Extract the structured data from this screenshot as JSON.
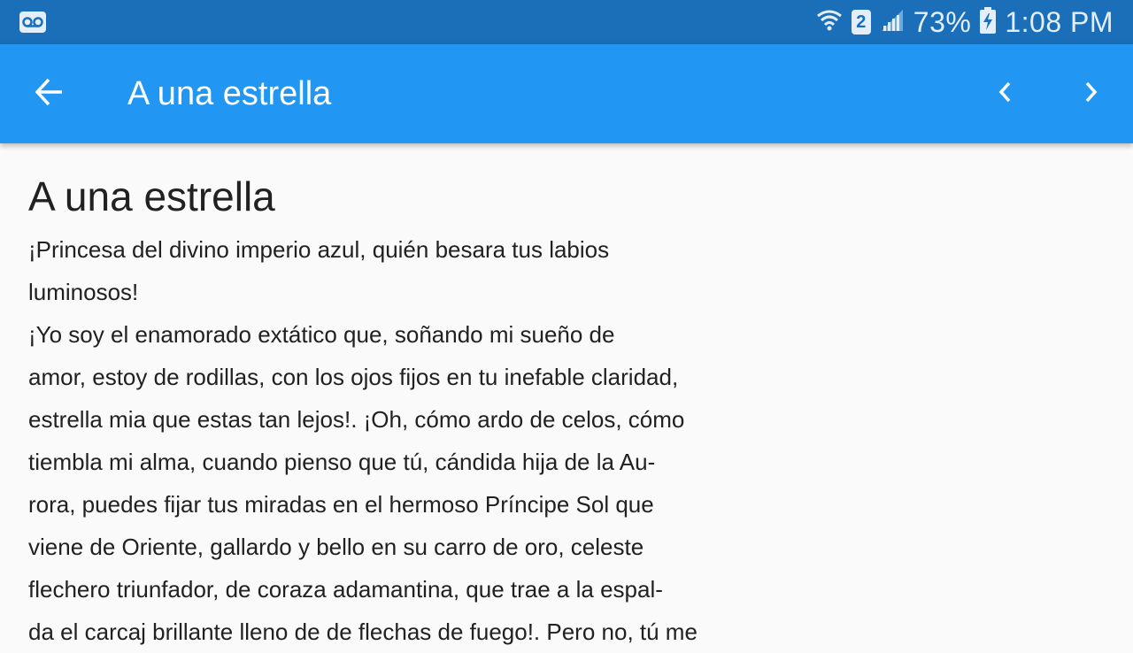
{
  "status_bar": {
    "battery_percent": "73%",
    "time": "1:08 PM",
    "sim_slot": "2",
    "icons": [
      "voicemail-icon",
      "wifi-icon",
      "sim-icon",
      "signal-icon",
      "battery-charging-icon"
    ]
  },
  "app_bar": {
    "title": "A una estrella",
    "icons": [
      "back-arrow-icon",
      "chevron-left-icon",
      "chevron-right-icon"
    ],
    "color": "#2196f3"
  },
  "poem": {
    "title": "A una estrella",
    "lines": [
      "¡Princesa del divino imperio azul, quién besara tus labios",
      "luminosos!",
      "¡Yo soy el enamorado extático que, soñando mi sueño de",
      "amor, estoy de rodillas, con los ojos fijos en tu inefable claridad,",
      "estrella mia que estas tan lejos!. ¡Oh, cómo ardo de celos, cómo",
      "tiembla mi alma, cuando pienso que tú, cándida hija de la Au-",
      "rora, puedes fijar tus miradas en el hermoso Príncipe Sol que",
      "viene de Oriente, gallardo y bello en su carro de oro, celeste",
      "flechero triunfador, de coraza adamantina, que trae a la espal-",
      "da el carcaj brillante lleno de de flechas de fuego!. Pero no, tú me"
    ]
  }
}
